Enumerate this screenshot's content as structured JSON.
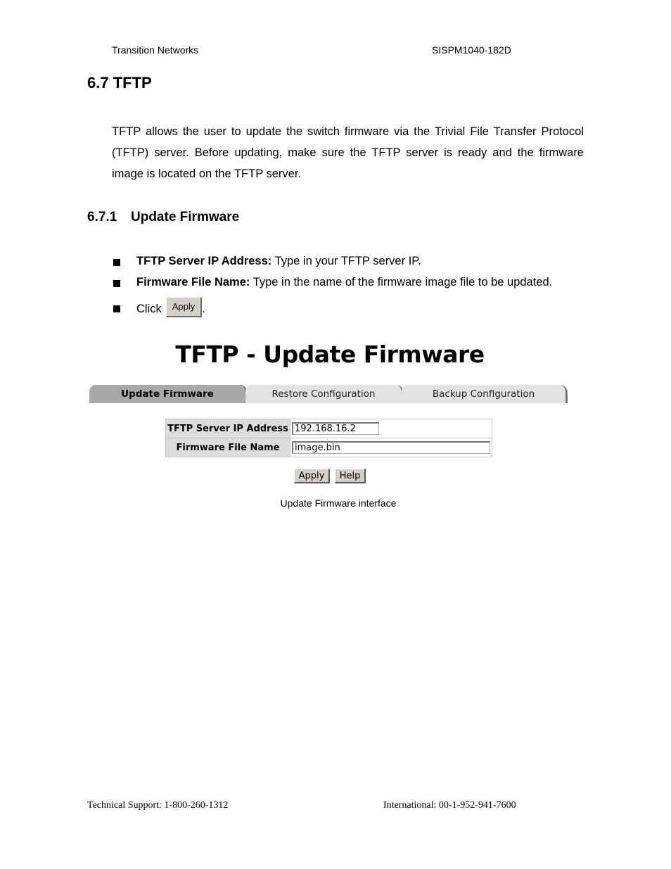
{
  "header": {
    "left": "Transition Networks",
    "right": "SISPM1040-182D"
  },
  "section": {
    "title": "6.7 TFTP"
  },
  "intro_paragraph": "TFTP allows the user to update the switch firmware via the Trivial File Transfer Protocol (TFTP) server. Before updating, make sure the TFTP server is ready and the firmware image is located on the TFTP server.",
  "subsection": {
    "number": "6.7.1",
    "title": "Update Firmware"
  },
  "bullets": [
    {
      "label": "TFTP Server IP Address:",
      "text": " Type in your TFTP server IP."
    },
    {
      "label": "Firmware File Name:",
      "text": " Type in the name of the firmware image file to be updated."
    },
    {
      "prefix": "Click",
      "button": "Apply",
      "suffix": "."
    }
  ],
  "ui": {
    "title": "TFTP - Update Firmware",
    "tabs": [
      {
        "label": "Update Firmware",
        "active": true
      },
      {
        "label": "Restore Configuration",
        "active": false
      },
      {
        "label": "Backup Configuration",
        "active": false
      }
    ],
    "fields": [
      {
        "label": "TFTP Server IP Address",
        "value": "192.168.16.2"
      },
      {
        "label": "Firmware File Name",
        "value": "image.bin"
      }
    ],
    "buttons": {
      "apply": "Apply",
      "help": "Help"
    },
    "colors": {
      "active_tab": "#a9a9a9",
      "inactive_tab": "#e3e3e3",
      "label_cell": "#dcdcdc",
      "button_face": "#d4d0c8"
    }
  },
  "caption": "Update Firmware interface",
  "footer": {
    "left": "Technical Support: 1-800-260-1312",
    "right": "International: 00-1-952-941-7600"
  }
}
